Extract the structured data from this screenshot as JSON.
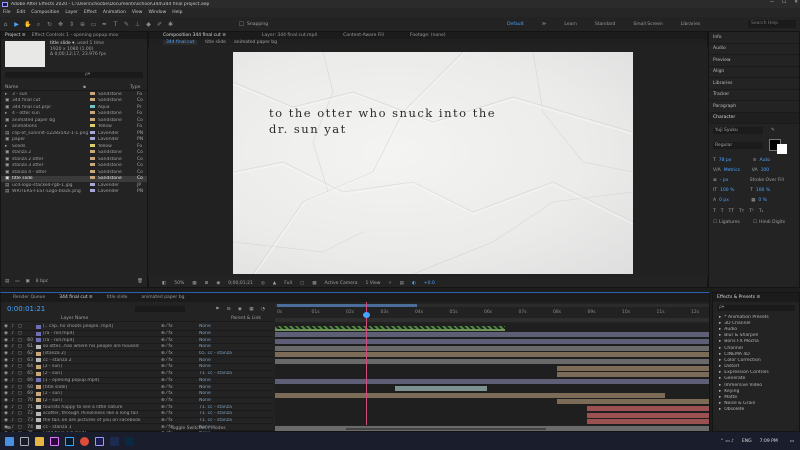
{
  "title_bar": {
    "title": "Adobe After Effects 2020 - C:\\Users\\chocbe\\Documents\\school\\344\\344 final project.aep",
    "minimize": "—",
    "maximize": "☐",
    "close": "✕"
  },
  "menu": [
    "File",
    "Edit",
    "Composition",
    "Layer",
    "Effect",
    "Animation",
    "View",
    "Window",
    "Help"
  ],
  "toolbar": {
    "snapping_label": "Snapping",
    "workspaces": [
      "Default",
      "≫",
      "Learn",
      "Standard",
      "Small Screen",
      "Libraries"
    ],
    "search_placeholder": "Search Help"
  },
  "project_panel": {
    "tabs": [
      "Project ≡",
      "Effect Controls 1 - opening popup.mov"
    ],
    "selected_name": "title slide ▾",
    "selected_used": ", used 1 time",
    "selected_dims": "1920 x 1080 (1.00)",
    "selected_duration": "Δ 0;00;12;17, 23.976 fps",
    "search_placeholder": "ρ▾",
    "col_name": "Name",
    "col_type": "Type",
    "items": [
      {
        "icon": "▸",
        "name": "3 - sun",
        "label": "Sandstone",
        "type": "Fo"
      },
      {
        "icon": "▣",
        "name": "344 final cut",
        "label": "Sandstone",
        "type": "Co"
      },
      {
        "icon": "▣",
        "name": "344 final cut.prpr",
        "label": "Aqua",
        "type": "Pr"
      },
      {
        "icon": "▸",
        "name": "4 - otter sun",
        "label": "Sandstone",
        "type": "Fo"
      },
      {
        "icon": "▣",
        "name": "animated paper bg",
        "label": "Sandstone",
        "type": "Co"
      },
      {
        "icon": "▸",
        "name": "animations",
        "label": "Yellow",
        "type": "Fo"
      },
      {
        "icon": "▤",
        "name": "clip-of_sunnnlt-1228x542-1-1.png",
        "label": "Lavender",
        "type": "PN"
      },
      {
        "icon": "▣",
        "name": "paper",
        "label": "Lavender",
        "type": "PN"
      },
      {
        "icon": "▸",
        "name": "Solids",
        "label": "Yellow",
        "type": "Fo"
      },
      {
        "icon": "▣",
        "name": "stanza 2",
        "label": "Sandstone",
        "type": "Co"
      },
      {
        "icon": "▣",
        "name": "stanza 2 otter",
        "label": "Sandstone",
        "type": "Co"
      },
      {
        "icon": "▣",
        "name": "stanza 3 otter",
        "label": "Sandstone",
        "type": "Co"
      },
      {
        "icon": "▣",
        "name": "stanza 4 - otter",
        "label": "Sandstone",
        "type": "Co"
      },
      {
        "icon": "▣",
        "name": "title slide",
        "label": "Sandstone",
        "type": "Co",
        "selected": true
      },
      {
        "icon": "▤",
        "name": "ucd-logo-stacked-rgb-1.jpg",
        "label": "Lavender",
        "type": "JP"
      },
      {
        "icon": "▤",
        "name": "WRITERS-FEST-Logo-black.png",
        "label": "Lavender",
        "type": "PN"
      }
    ],
    "footer_bpc": "8 bpc"
  },
  "comp_panel": {
    "tabs": [
      "Composition 344 final cut ≡",
      "Layer: 344 final cut.mp4",
      "Content-Aware Fill",
      "Footage: (none)"
    ],
    "breadcrumbs": [
      "344 final cut",
      "title slide",
      "animated paper bg"
    ],
    "caption_line1": "to the otter who snuck into the",
    "caption_line2": "dr. sun yat",
    "footer": {
      "zoom": "50%",
      "timecode": "0;00;01;21",
      "resolution": "Full",
      "camera": "Active Camera",
      "views": "1 View",
      "exposure": "+0.0"
    }
  },
  "right_panels": {
    "items": [
      "Info",
      "Audio",
      "Preview",
      "Align",
      "Libraries",
      "Tracker",
      "Paragraph"
    ],
    "character": {
      "title": "Character",
      "font": "Yuji Syuku",
      "style": "Regular",
      "size": "78 px",
      "leading": "Auto",
      "kerning": "Metrics",
      "tracking": "100",
      "stroke": "Stroke Over Fill",
      "stroke_width": "- px",
      "vscale": "100 %",
      "hscale": "100 %",
      "baseline": "0 px",
      "tsume": "0 %",
      "ligatures": "Ligatures",
      "hindi": "Hindi Digits"
    }
  },
  "timeline": {
    "tabs": [
      "Render Queue",
      "344 final cut ≡",
      "title slide",
      "animated paper bg"
    ],
    "timecode": "0:00:01:21",
    "col_source": "Layer Name",
    "col_parent": "Parent & Link",
    "ruler": [
      "0s",
      "01s",
      "02s",
      "03s",
      "04s",
      "05s",
      "06s",
      "07s",
      "08s",
      "09s",
      "10s",
      "11s",
      "12s"
    ],
    "footer": "Toggle Switches / Modes",
    "layers": [
      {
        "num": "",
        "name": "[.. clip..ho shoots people..mp4]",
        "parent": "None",
        "color": "#6f6fb8"
      },
      {
        "num": "",
        "name": "[ra - roll.mp4]",
        "parent": "None",
        "color": "#6f6fb8"
      },
      {
        "num": "60",
        "name": "[ra - roll.mp4]",
        "parent": "None",
        "color": "#6f6fb8"
      },
      {
        "num": "61",
        "name": "so otter...has where his people are housed",
        "parent": "None",
        "color": "#b8b8b8"
      },
      {
        "num": "62",
        "name": "[stanza 2]",
        "parent": "65. cc - stanza",
        "color": "#c9a77a"
      },
      {
        "num": "63",
        "name": "cc - stanza 2",
        "parent": "None",
        "color": "#b8b8b8"
      },
      {
        "num": "64",
        "name": "[2 - sun]",
        "parent": "None",
        "color": "#c9a77a"
      },
      {
        "num": "65",
        "name": "[2 - sun]",
        "parent": "71. cc - stanza",
        "color": "#c9a77a"
      },
      {
        "num": "66",
        "name": "[1 - opening popup.mp4]",
        "parent": "None",
        "color": "#6f6fb8"
      },
      {
        "num": "68",
        "name": "[title slide]",
        "parent": "None",
        "color": "#c9a77a"
      },
      {
        "num": "69",
        "name": "[2 - sun]",
        "parent": "None",
        "color": "#c9a77a"
      },
      {
        "num": "70",
        "name": "[2 - sun]",
        "parent": "None",
        "color": "#c9a77a"
      },
      {
        "num": "71",
        "name": "tourists happy to see a little nature",
        "parent": "71. cc - stanza",
        "color": "#b8b8b8"
      },
      {
        "num": "72",
        "name": "scatter, through rhinoliness like a long tail",
        "parent": "71. cc - stanza",
        "color": "#b8b8b8"
      },
      {
        "num": "73",
        "name": "the tail..on are pictures of you on Facebook",
        "parent": "71. cc - stanza",
        "color": "#b8b8b8"
      },
      {
        "num": "74",
        "name": "cc - stanza 1",
        "parent": "None",
        "color": "#b8b8b8"
      },
      {
        "num": "75",
        "name": "[344 final cut.mp4]",
        "parent": "None",
        "color": "#6f6fb8"
      }
    ]
  },
  "effects_panel": {
    "title": "Effects & Presets ≡",
    "search_placeholder": "ρ▾",
    "items": [
      "* Animation Presets",
      "3D Channel",
      "Audio",
      "Blur & Sharpen",
      "Boris FX Mocha",
      "Channel",
      "CINEMA 4D",
      "Color Correction",
      "Distort",
      "Expression Controls",
      "Generate",
      "Immersive Video",
      "Keying",
      "Matte",
      "Noise & Grain",
      "Obsolete"
    ]
  },
  "taskbar": {
    "lang": "ENG",
    "time": "7:09 PM"
  },
  "colors": {
    "accent": "#4aa3ff",
    "playhead": "#d24b7e",
    "sandstone": "#c9a77a",
    "lavender": "#a6a6d8",
    "aqua": "#6fc3c3",
    "yellow": "#d8cf6a"
  }
}
